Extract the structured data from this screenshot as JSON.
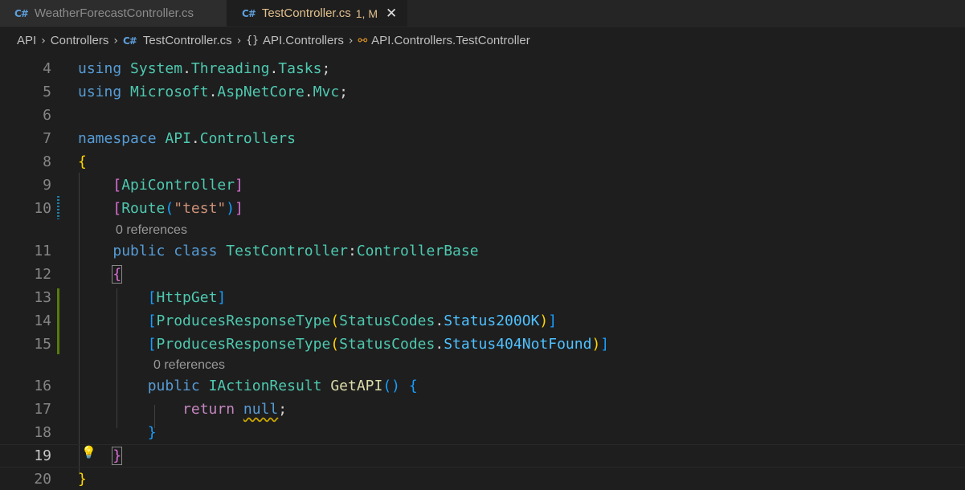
{
  "tabs": [
    {
      "icon": "C#",
      "label": "WeatherForecastController.cs",
      "status": "",
      "active": false
    },
    {
      "icon": "C#",
      "label": "TestController.cs",
      "status": "1, M",
      "active": true
    }
  ],
  "close_glyph": "✕",
  "breadcrumb": {
    "root": "API",
    "folder": "Controllers",
    "file": "TestController.cs",
    "namespace": "API.Controllers",
    "class": "API.Controllers.TestController"
  },
  "editor": {
    "lines": {
      "n4": "4",
      "n5": "5",
      "n6": "6",
      "n7": "7",
      "n8": "8",
      "n9": "9",
      "n10": "10",
      "n11": "11",
      "n12": "12",
      "n13": "13",
      "n14": "14",
      "n15": "15",
      "n16": "16",
      "n17": "17",
      "n18": "18",
      "n19": "19",
      "n20": "20"
    },
    "tokens": {
      "using": "using",
      "system": "System",
      "threading": "Threading",
      "tasks": "Tasks",
      "microsoft": "Microsoft",
      "aspnetcore": "AspNetCore",
      "mvc": "Mvc",
      "namespace_kw": "namespace",
      "api": "API",
      "controllers": "Controllers",
      "apicontroller": "ApiController",
      "route": "Route",
      "route_arg": "\"test\"",
      "public": "public",
      "class": "class",
      "class_name": "TestController",
      "base_class": "ControllerBase",
      "httpget": "HttpGet",
      "produces": "ProducesResponseType",
      "statuscodes": "StatusCodes",
      "status200": "Status200OK",
      "status404": "Status404NotFound",
      "iactionresult": "IActionResult",
      "getapi": "GetAPI",
      "return": "return",
      "null": "null"
    },
    "codelens_1": "0 references",
    "codelens_2": "0 references"
  },
  "colors": {
    "keyword": "#569cd6",
    "type": "#4ec9b0",
    "string": "#ce9178",
    "control": "#c586c0",
    "property": "#4fc1ff",
    "method": "#dcdcaa",
    "modified_tab": "#e2c08d"
  }
}
